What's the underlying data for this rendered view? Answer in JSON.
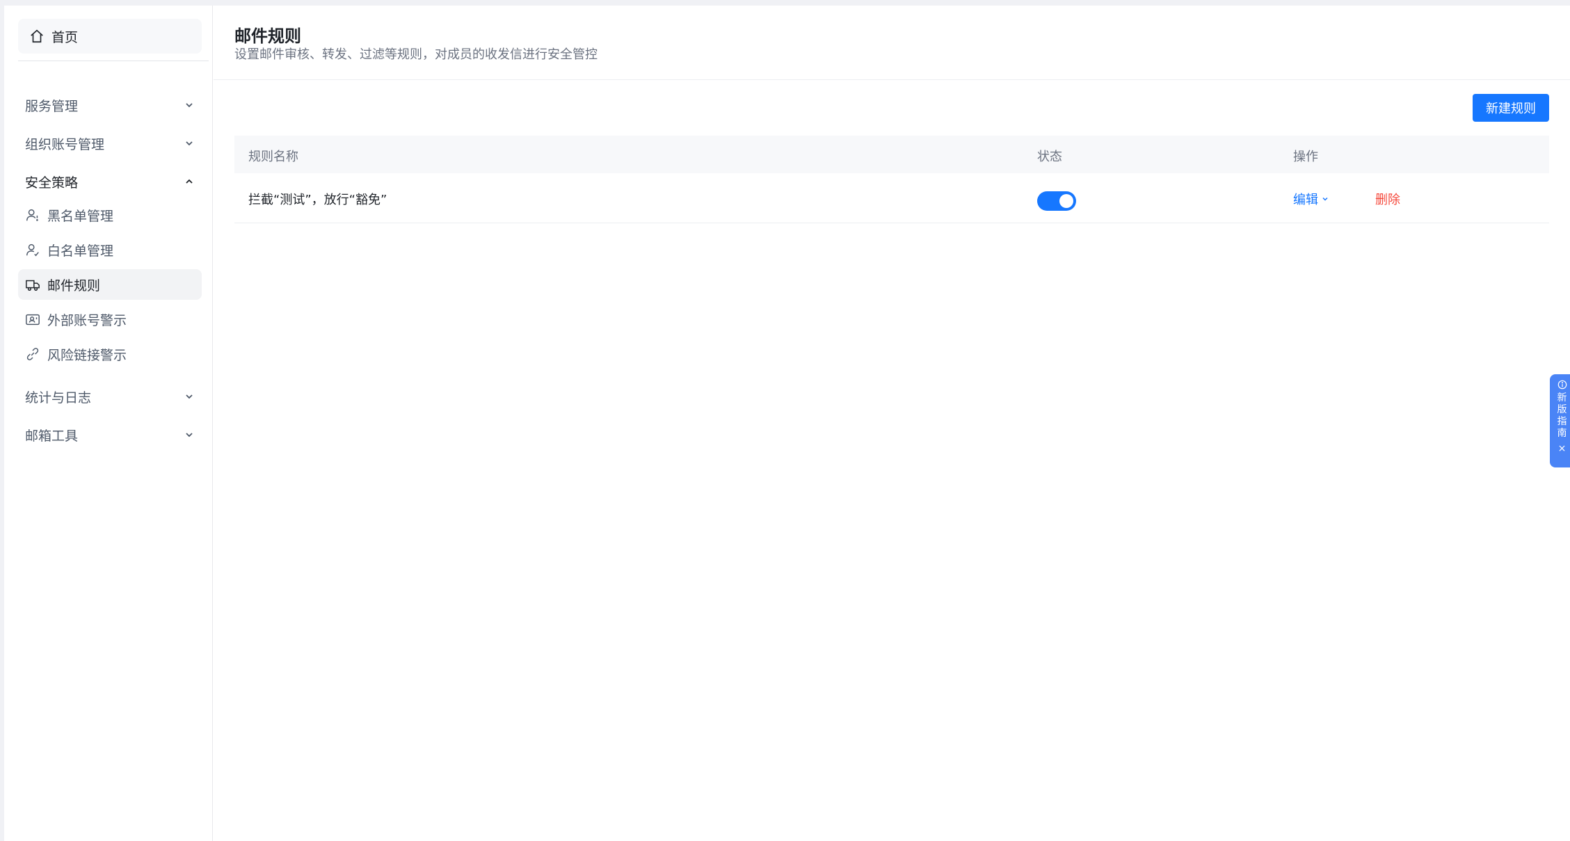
{
  "sidebar": {
    "home": "首页",
    "groups": {
      "service": "服务管理",
      "org": "组织账号管理",
      "security": "安全策略",
      "stats": "统计与日志",
      "tools": "邮箱工具"
    },
    "security_items": [
      "黑名单管理",
      "白名单管理",
      "邮件规则",
      "外部账号警示",
      "风险链接警示"
    ]
  },
  "header": {
    "title": "邮件规则",
    "description": "设置邮件审核、转发、过滤等规则，对成员的收发信进行安全管控"
  },
  "toolbar": {
    "new_rule": "新建规则"
  },
  "table": {
    "columns": [
      "规则名称",
      "状态",
      "操作"
    ],
    "rows": [
      {
        "name": "拦截“测试”，放行“豁免”",
        "enabled": true,
        "edit": "编辑",
        "delete": "删除"
      }
    ]
  },
  "guide": {
    "label": "新版指南",
    "close": "×"
  },
  "colors": {
    "primary": "#1677ff",
    "danger": "#f5483b",
    "guide": "#4a84f6"
  }
}
